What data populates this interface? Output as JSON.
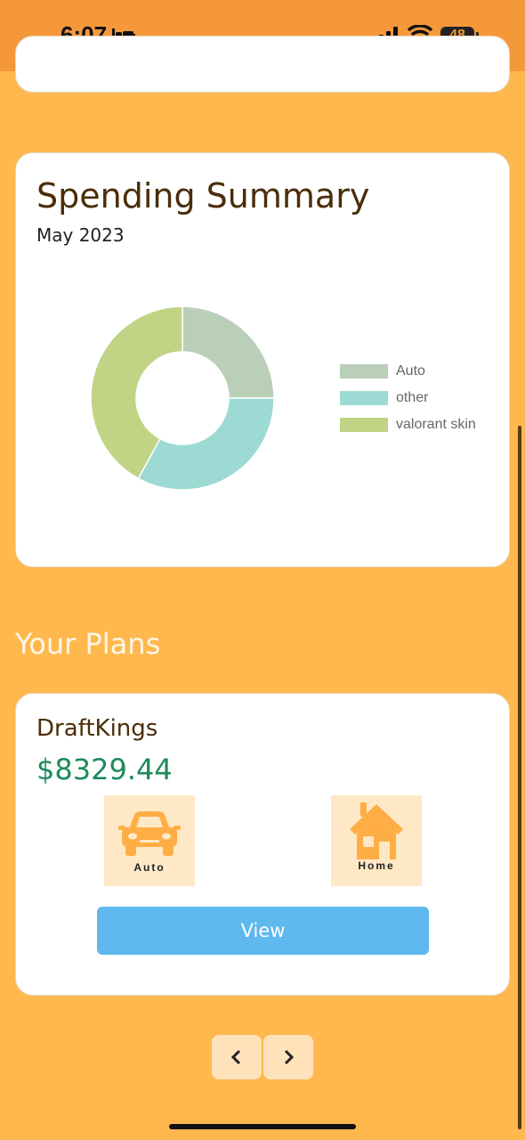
{
  "status_bar": {
    "time": "6:07",
    "battery": "48"
  },
  "spending_summary": {
    "title": "Spending Summary",
    "month": "May 2023"
  },
  "chart_data": {
    "type": "pie",
    "title": "",
    "legend_position": "right",
    "series": [
      {
        "name": "Auto",
        "value": 25,
        "color": "#BACFB7"
      },
      {
        "name": "other",
        "value": 33,
        "color": "#9CDAD3"
      },
      {
        "name": "valorant skin",
        "value": 42,
        "color": "#C1D485"
      }
    ]
  },
  "plans": {
    "heading": "Your Plans",
    "card": {
      "name": "DraftKings",
      "amount": "$8329.44",
      "categories": [
        {
          "label": "Auto",
          "icon": "car-icon"
        },
        {
          "label": "Home",
          "icon": "home-icon"
        }
      ],
      "view_label": "View"
    }
  },
  "pagination": {
    "prev_icon": "chevron-left-icon",
    "next_icon": "chevron-right-icon"
  },
  "colors": {
    "background": "#FFB84D",
    "status_bar": "#F5983A",
    "amount": "#1E8A5A",
    "button": "#5FB8EE"
  }
}
